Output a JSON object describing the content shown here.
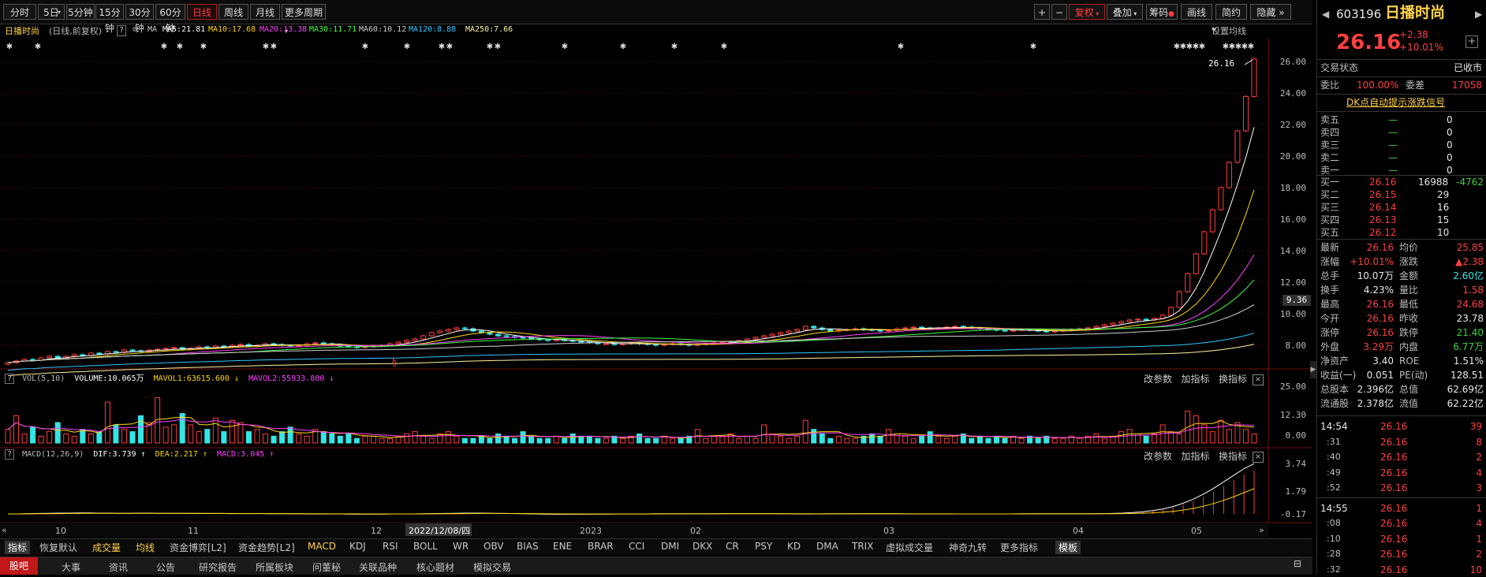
{
  "toolbar": {
    "periods": [
      "分时",
      "5日",
      "5分钟",
      "15分钟",
      "30分钟",
      "60分钟",
      "日线",
      "周线",
      "月线",
      "更多周期"
    ],
    "active_period": "日线",
    "right_buttons": [
      "复权",
      "叠加",
      "筹码",
      "画线",
      "简约",
      "隐藏"
    ],
    "plus": "+",
    "minus": "−"
  },
  "chart_header": {
    "stock_name": "日播时尚",
    "mode": "(日线,前复权)",
    "help": "?",
    "ma_label": "MA",
    "ma": [
      {
        "text": "MA5:21.81",
        "color": "#ffffff"
      },
      {
        "text": "MA10:17.68",
        "color": "#ffd700"
      },
      {
        "text": "MA20:13.38",
        "color": "#ff40ff"
      },
      {
        "text": "MA30:11.71",
        "color": "#40ff40"
      },
      {
        "text": "MA60:10.12",
        "color": "#cfcfcf"
      },
      {
        "text": "MA120:8.88",
        "color": "#30c8ff"
      },
      {
        "text": "MA250:7.66",
        "color": "#fff59d"
      }
    ],
    "settings": "设置均线"
  },
  "price_axis": [
    "26.00",
    "24.00",
    "22.00",
    "20.00",
    "18.00",
    "16.00",
    "14.00",
    "12.00",
    "10.00",
    "8.00"
  ],
  "current_price_tag": "9.36",
  "last_price_label": "26.16",
  "low_marker": "§",
  "volume_panel": {
    "label": "VOL(5,10)",
    "volume": "VOLUME:10.065万",
    "mavol1": "MAVOL1:63615.600",
    "mavol2": "MAVOL2:55933.800",
    "axis": [
      "25.00",
      "12.30",
      "0.00"
    ],
    "buttons": [
      "改参数",
      "加指标",
      "换指标"
    ]
  },
  "macd_panel": {
    "label": "MACD(12,26,9)",
    "dif": "DIF:3.739",
    "dea": "DEA:2.217",
    "macd": "MACD:3.045",
    "axis": [
      "3.74",
      "1.79",
      "-0.17"
    ],
    "buttons": [
      "改参数",
      "加指标",
      "换指标"
    ]
  },
  "time_axis": {
    "labels": [
      "10",
      "11",
      "12",
      "2022/12/08/四",
      "2023",
      "02",
      "03",
      "04",
      "05"
    ]
  },
  "indicator_tabs": [
    "指标",
    "恢复默认",
    "成交量",
    "均线",
    "资金博弈[L2]",
    "资金趋势[L2]",
    "MACD",
    "KDJ",
    "RSI",
    "BOLL",
    "WR",
    "OBV",
    "BIAS",
    "ENE",
    "BRAR",
    "CCI",
    "DMI",
    "DKX",
    "CR",
    "PSY",
    "KD",
    "DMA",
    "TRIX",
    "虚拟成交量",
    "神奇九转",
    "更多指标",
    "模板"
  ],
  "bottom_tabs": [
    "股吧",
    "大事",
    "资讯",
    "公告",
    "研究报告",
    "所属板块",
    "问董秘",
    "关联品种",
    "核心题材",
    "模拟交易"
  ],
  "quote": {
    "code": "603196",
    "name": "日播时尚",
    "price": "26.16",
    "change": "+2.38",
    "change_pct": "+10.01%",
    "status_label": "交易状态",
    "status": "已收市",
    "ratio_label": "委比",
    "ratio": "100.00%",
    "diff_label": "委差",
    "diff": "17058",
    "signal": "DK点自动提示涨跌信号",
    "sells": [
      {
        "label": "卖五",
        "price": "—",
        "vol": "0"
      },
      {
        "label": "卖四",
        "price": "—",
        "vol": "0"
      },
      {
        "label": "卖三",
        "price": "—",
        "vol": "0"
      },
      {
        "label": "卖二",
        "price": "—",
        "vol": "0"
      },
      {
        "label": "卖一",
        "price": "—",
        "vol": "0"
      }
    ],
    "buys": [
      {
        "label": "买一",
        "price": "26.16",
        "vol": "16988",
        "extra": "-4762"
      },
      {
        "label": "买二",
        "price": "26.15",
        "vol": "29",
        "extra": ""
      },
      {
        "label": "买三",
        "price": "26.14",
        "vol": "16",
        "extra": ""
      },
      {
        "label": "买四",
        "price": "26.13",
        "vol": "15",
        "extra": ""
      },
      {
        "label": "买五",
        "price": "26.12",
        "vol": "10",
        "extra": ""
      }
    ],
    "stats": [
      {
        "l1": "最新",
        "v1": "26.16",
        "c1": "red",
        "l2": "均价",
        "v2": "25.85",
        "c2": "red"
      },
      {
        "l1": "涨幅",
        "v1": "+10.01%",
        "c1": "red",
        "l2": "涨跌",
        "v2": "▲2.38",
        "c2": "red"
      },
      {
        "l1": "总手",
        "v1": "10.07万",
        "c1": "wht",
        "l2": "金额",
        "v2": "2.60亿",
        "c2": "cyan"
      },
      {
        "l1": "换手",
        "v1": "4.23%",
        "c1": "wht",
        "l2": "量比",
        "v2": "1.58",
        "c2": "red"
      },
      {
        "l1": "最高",
        "v1": "26.16",
        "c1": "red",
        "l2": "最低",
        "v2": "24.68",
        "c2": "red"
      },
      {
        "l1": "今开",
        "v1": "26.16",
        "c1": "red",
        "l2": "昨收",
        "v2": "23.78",
        "c2": "wht"
      },
      {
        "l1": "涨停",
        "v1": "26.16",
        "c1": "red",
        "l2": "跌停",
        "v2": "21.40",
        "c2": "grn"
      },
      {
        "l1": "外盘",
        "v1": "3.29万",
        "c1": "red",
        "l2": "内盘",
        "v2": "6.77万",
        "c2": "grn"
      },
      {
        "l1": "净资产",
        "v1": "3.40",
        "c1": "wht",
        "l2": "ROE",
        "v2": "1.51%",
        "c2": "wht"
      },
      {
        "l1": "收益(一)",
        "v1": "0.051",
        "c1": "wht",
        "l2": "PE(动)",
        "v2": "128.51",
        "c2": "wht"
      },
      {
        "l1": "总股本",
        "v1": "2.396亿",
        "c1": "wht",
        "l2": "总值",
        "v2": "62.69亿",
        "c2": "wht"
      },
      {
        "l1": "流通股",
        "v1": "2.378亿",
        "c1": "wht",
        "l2": "流值",
        "v2": "62.22亿",
        "c2": "wht"
      }
    ],
    "ticks": [
      {
        "t": "14:54",
        "p": "26.16",
        "v": "39"
      },
      {
        "t": ":31",
        "p": "26.16",
        "v": "8"
      },
      {
        "t": ":40",
        "p": "26.16",
        "v": "2"
      },
      {
        "t": ":49",
        "p": "26.16",
        "v": "4"
      },
      {
        "t": ":52",
        "p": "26.16",
        "v": "3"
      },
      {
        "t": "14:55",
        "p": "26.16",
        "v": "1"
      },
      {
        "t": ":08",
        "p": "26.16",
        "v": "4"
      },
      {
        "t": ":10",
        "p": "26.16",
        "v": "1"
      },
      {
        "t": ":28",
        "p": "26.16",
        "v": "2"
      },
      {
        "t": ":32",
        "p": "26.16",
        "v": "10"
      }
    ]
  },
  "chart_data": {
    "type": "candlestick",
    "x_labels": [
      "10",
      "11",
      "12",
      "2023",
      "02",
      "03",
      "04",
      "05"
    ],
    "ylim": [
      6.8,
      26.8
    ],
    "close": [
      6.9,
      7.0,
      7.1,
      7.05,
      7.2,
      7.3,
      7.2,
      7.3,
      7.4,
      7.35,
      7.5,
      7.45,
      7.6,
      7.55,
      7.7,
      7.65,
      7.6,
      7.7,
      7.75,
      7.8,
      7.85,
      7.75,
      7.8,
      7.9,
      7.85,
      7.95,
      7.9,
      8.0,
      8.05,
      7.95,
      8.0,
      8.1,
      8.05,
      8.0,
      7.95,
      8.0,
      8.1,
      8.15,
      8.1,
      8.05,
      7.95,
      7.9,
      7.85,
      7.9,
      7.95,
      8.0,
      8.1,
      8.2,
      8.3,
      8.4,
      8.6,
      8.8,
      8.9,
      9.0,
      9.1,
      9.05,
      8.9,
      8.8,
      8.7,
      8.6,
      8.55,
      8.5,
      8.45,
      8.4,
      8.35,
      8.3,
      8.35,
      8.3,
      8.25,
      8.2,
      8.15,
      8.1,
      8.1,
      8.05,
      8.1,
      8.15,
      8.1,
      8.05,
      8.0,
      8.05,
      8.1,
      8.05,
      8.0,
      8.05,
      8.1,
      8.15,
      8.2,
      8.25,
      8.3,
      8.4,
      8.5,
      8.6,
      8.7,
      8.8,
      8.9,
      9.0,
      9.2,
      9.1,
      9.0,
      8.9,
      8.95,
      9.0,
      9.05,
      9.0,
      8.95,
      8.9,
      8.95,
      9.05,
      9.1,
      9.15,
      9.1,
      9.05,
      9.1,
      9.15,
      9.2,
      9.15,
      9.1,
      9.05,
      9.0,
      8.95,
      8.9,
      8.95,
      9.0,
      8.95,
      8.9,
      8.85,
      8.9,
      8.95,
      9.0,
      9.05,
      9.1,
      9.2,
      9.3,
      9.4,
      9.5,
      9.6,
      9.65,
      9.6,
      9.7,
      9.9,
      10.4,
      11.4,
      12.55,
      13.8,
      15.2,
      16.6,
      18.0,
      19.6,
      21.6,
      23.78,
      26.16
    ],
    "volume": [
      6,
      12,
      4,
      7,
      3,
      5,
      9,
      4,
      3,
      6,
      4,
      5,
      18,
      8,
      6,
      5,
      12,
      9,
      20,
      7,
      8,
      13,
      8,
      5,
      6,
      11,
      5,
      10,
      9,
      5,
      6,
      4,
      3,
      5,
      7,
      4,
      3,
      6,
      5,
      4,
      3,
      4,
      2,
      3,
      3,
      2,
      2,
      3,
      4,
      5,
      3,
      2,
      4,
      5,
      3,
      2,
      2,
      3,
      2,
      4,
      3,
      2,
      5,
      3,
      2,
      2,
      3,
      2,
      4,
      3,
      3,
      2,
      2,
      3,
      2,
      3,
      4,
      2,
      2,
      3,
      2,
      2,
      3,
      6,
      2,
      3,
      3,
      4,
      2,
      3,
      2,
      8,
      4,
      3,
      2,
      3,
      10,
      6,
      4,
      2,
      3,
      2,
      2,
      3,
      4,
      3,
      6,
      4,
      3,
      2,
      3,
      5,
      3,
      2,
      3,
      4,
      2,
      3,
      2,
      3,
      2,
      3,
      2,
      3,
      2,
      3,
      2,
      2,
      3,
      2,
      3,
      4,
      2,
      3,
      5,
      6,
      4,
      3,
      4,
      8,
      5,
      4,
      14,
      12,
      8,
      5,
      10,
      6,
      9,
      6,
      4,
      9
    ],
    "macd": [
      0,
      0,
      0.02,
      0.03,
      0.04,
      0.05,
      0.05,
      0.06,
      0.06,
      0.05,
      0.05,
      0.04,
      0.04,
      0.05,
      0.05,
      0.04,
      0.04,
      0.04,
      0.03,
      0.03,
      0.03,
      0.03,
      0.02,
      0.02,
      0.02,
      0.02,
      0.01,
      0.01,
      0.01,
      0.01,
      0.0,
      0.0,
      0.0,
      0.0,
      -0.01,
      -0.01,
      -0.01,
      -0.01,
      0.0,
      0.0,
      0.0,
      0.01,
      0.02,
      0.03,
      0.04,
      0.05,
      0.05,
      0.05,
      0.04,
      0.03,
      0.02,
      0.01,
      0.0,
      -0.01,
      -0.02,
      -0.02,
      -0.02,
      -0.02,
      -0.01,
      -0.01,
      0.0,
      0.0,
      0.0,
      0.0,
      0.01,
      0.01,
      0.01,
      0.01,
      0.01,
      0.01,
      0.01,
      0.02,
      0.02,
      0.02,
      0.02,
      0.02,
      0.01,
      0.01,
      0.0,
      0.0,
      0.0,
      0.01,
      0.01,
      0.01,
      0.01,
      0.01,
      0.01,
      0.01,
      0.01,
      0.0,
      0.0,
      0.0,
      0.0,
      0.0,
      0.0,
      0.0,
      0.0,
      0.0,
      0.0,
      0.0,
      0.01,
      0.01,
      0.01,
      0.01,
      0.01,
      0.01,
      0.01,
      0.01,
      0.02,
      0.03,
      0.05,
      0.08,
      0.13,
      0.2,
      0.3,
      0.45,
      0.65,
      0.9,
      1.2,
      1.55,
      1.95,
      2.35,
      2.75,
      3.05
    ]
  }
}
